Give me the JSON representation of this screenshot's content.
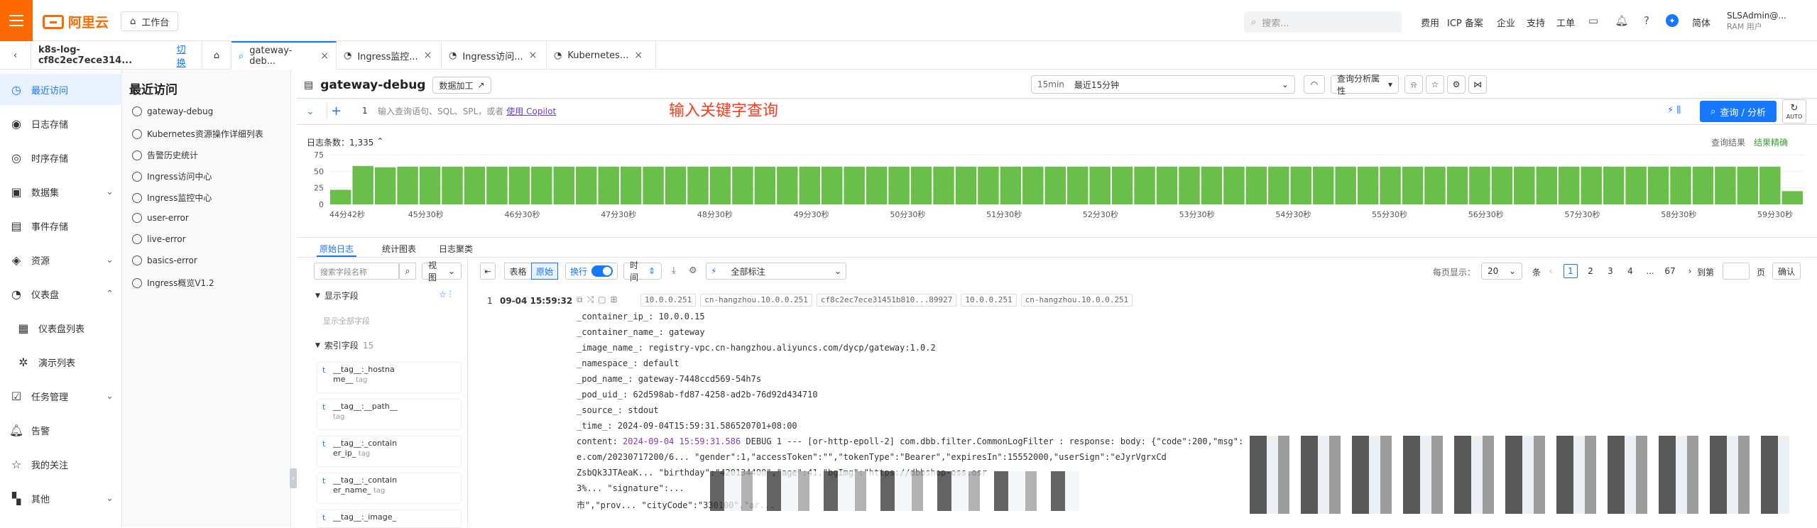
{
  "topbar": {
    "logo_text": "阿里云",
    "workbench": "工作台",
    "search_placeholder": "搜索...",
    "nav": [
      "费用",
      "ICP 备案",
      "企业",
      "支持",
      "工单"
    ],
    "lang": "简体",
    "user_name": "SLSAdmin@...",
    "user_role": "RAM 用户"
  },
  "tabs": {
    "project": "k8s-log-cf8c2ec7ece314...",
    "switch": "切换",
    "items": [
      "gateway-deb...",
      "Ingress监控...",
      "Ingress访问...",
      "Kubernetes..."
    ]
  },
  "sidebar": {
    "items": [
      {
        "label": "最近访问",
        "icon": "clock-icon"
      },
      {
        "label": "日志存储",
        "icon": "log-store-icon"
      },
      {
        "label": "时序存储",
        "icon": "metric-store-icon"
      },
      {
        "label": "数据集",
        "icon": "dataset-icon"
      },
      {
        "label": "事件存储",
        "icon": "event-store-icon"
      },
      {
        "label": "资源",
        "icon": "resource-icon"
      },
      {
        "label": "仪表盘",
        "icon": "dashboard-icon"
      },
      {
        "label": "仪表盘列表",
        "icon": "dashboard-list-icon"
      },
      {
        "label": "演示列表",
        "icon": "demo-list-icon"
      },
      {
        "label": "任务管理",
        "icon": "task-icon"
      },
      {
        "label": "告警",
        "icon": "bell-icon"
      },
      {
        "label": "我的关注",
        "icon": "star-icon"
      },
      {
        "label": "其他",
        "icon": "grid-icon"
      }
    ]
  },
  "recent": {
    "title": "最近访问",
    "items": [
      "gateway-debug",
      "Kubernetes资源操作详细列表",
      "告警历史统计",
      "Ingress访问中心",
      "Ingress监控中心",
      "user-error",
      "live-error",
      "basics-error",
      "Ingress概览V1.2"
    ]
  },
  "logstore": {
    "name": "gateway-debug",
    "data_process": "数据加工",
    "time_quick": "15min",
    "time_range": "最近15分钟",
    "analysis_props": "查询分析属性"
  },
  "query": {
    "line_no": "1",
    "placeholder": "输入查询语句、SQL、SPL，或者",
    "copilot_link": "使用 Copilot",
    "annotation": "输入关键字查询",
    "submit": "查询 / 分析",
    "auto": "AUTO"
  },
  "histogram": {
    "count_label": "日志条数：1,335",
    "query_result": "查询结果",
    "result_accurate": "结果精确",
    "accent": "#6abf4b"
  },
  "chart_data": {
    "type": "bar",
    "ylim": [
      0,
      75
    ],
    "yticks": [
      "75",
      "50",
      "25",
      "0"
    ],
    "xticks": [
      "44分42秒",
      "45分30秒",
      "46分30秒",
      "47分30秒",
      "48分30秒",
      "49分30秒",
      "50分30秒",
      "51分30秒",
      "52分30秒",
      "53分30秒",
      "54分30秒",
      "55分30秒",
      "56分30秒",
      "57分30秒",
      "58分30秒",
      "59分30秒"
    ],
    "values": [
      22,
      58,
      56,
      57,
      57,
      57,
      57,
      57,
      57,
      57,
      57,
      57,
      57,
      57,
      57,
      57,
      57,
      57,
      57,
      57,
      57,
      57,
      57,
      57,
      57,
      57,
      57,
      57,
      57,
      57,
      57,
      57,
      57,
      57,
      57,
      57,
      57,
      57,
      57,
      57,
      57,
      57,
      57,
      57,
      57,
      57,
      57,
      57,
      57,
      57,
      57,
      57,
      57,
      57,
      57,
      57,
      57,
      57,
      57,
      57,
      57,
      57,
      57,
      57,
      57,
      20
    ]
  },
  "view_tabs": [
    "原始日志",
    "统计图表",
    "日志聚类"
  ],
  "fields": {
    "search_placeholder": "搜索字段名称",
    "view": "视图",
    "display_fields": "显示字段",
    "show_all": "显示全部字段",
    "index_fields": "索引字段",
    "index_count": "15",
    "items": [
      {
        "type": "t",
        "name1": "__tag__:_hostna",
        "name2": "me__",
        "tag": "tag"
      },
      {
        "type": "t",
        "name1": "__tag__:__path__",
        "name2": "",
        "tag": "tag"
      },
      {
        "type": "t",
        "name1": "__tag__:_contain",
        "name2": "er_ip_",
        "tag": "tag"
      },
      {
        "type": "t",
        "name1": "__tag__:_contain",
        "name2": "er_name_",
        "tag": "tag"
      },
      {
        "type": "t",
        "name1": "__tag__:_image_",
        "name2": "",
        "tag": ""
      }
    ]
  },
  "log_toolbar": {
    "table": "表格",
    "raw": "原始",
    "wrap": "换行",
    "time": "时间",
    "all_marks": "全部标注",
    "per_page_label": "每页显示：",
    "per_page": "20",
    "unit": "条",
    "pages": [
      "1",
      "2",
      "3",
      "4",
      "...",
      "67"
    ],
    "goto": "到第",
    "page_unit": "页",
    "confirm": "确认"
  },
  "log": {
    "index": "1",
    "time": "09-04 15:59:32",
    "chips": [
      "10.0.0.251",
      "cn-hangzhou.10.0.0.251",
      "cf8c2ec7ece31451b810...89927",
      "10.0.0.251",
      "cn-hangzhou.10.0.0.251"
    ],
    "lines": [
      "_container_ip_: 10.0.0.15",
      "_container_name_: gateway",
      "_image_name_: registry-vpc.cn-hangzhou.aliyuncs.com/dycp/gateway:1.0.2",
      "_namespace_: default",
      "_pod_name_: gateway-7448ccd569-54h7s",
      "_pod_uid_: 62d598ab-fd87-4258-ad2b-76d92d434710",
      "_source_: stdout",
      "_time_: 2024-09-04T15:59:31.586520701+08:00"
    ],
    "content_key": "content: ",
    "content_ts": "2024-09-04 15:59:31.586",
    "content_rest": " DEBUG 1 --- [or-http-epoll-2] com.dbb.filter.CommonLogFilter            : response: body: {\"code\":200,\"msg\":",
    "content_line2": "e.com/20230717200/6...  \"gender\":1,\"accessToken\":\"\",\"tokenType\":\"Bearer\",\"expiresIn\":15552000,\"userSign\":\"eJyrVgrxCd",
    "content_line3": "ZsbQk3JTAeaK...   \"birthday\":\"420134400\",\"age\":41,\"bgImg\":\"https://dbbshop-oss.osr",
    "content_line4": "3%...  \"signature\":...",
    "content_line5": "市\",\"prov...    \"cityCode\":\"330100\",\"ar..."
  }
}
